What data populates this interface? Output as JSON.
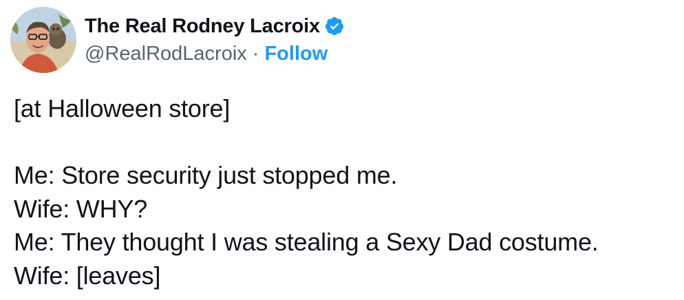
{
  "author": {
    "display_name": "The Real Rodney Lacroix",
    "handle": "@RealRodLacroix",
    "separator": "·",
    "follow_label": "Follow",
    "verified_icon": "verified-badge-icon",
    "verified_color": "#1d9bf0"
  },
  "tweet": {
    "lines": [
      "[at Halloween store]",
      "",
      "Me: Store security just stopped me.",
      "Wife: WHY?",
      "Me: They thought I was stealing a Sexy Dad costume.",
      "Wife: [leaves]"
    ]
  },
  "colors": {
    "text": "#0f1419",
    "secondary_text": "#536471",
    "link": "#1d9bf0",
    "background": "#ffffff"
  }
}
